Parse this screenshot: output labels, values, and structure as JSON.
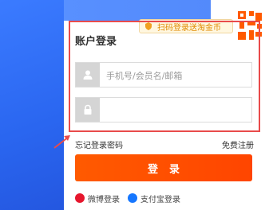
{
  "qr_banner": {
    "text": "扫码登录送淘金币"
  },
  "login": {
    "title": "账户登录",
    "username_placeholder": "手机号/会员名/邮箱",
    "password_placeholder": ""
  },
  "links": {
    "forgot_password": "忘记登录密码",
    "register": "免费注册"
  },
  "login_button": {
    "label": "登录"
  },
  "alt_login": {
    "weibo": "微博登录",
    "alipay": "支付宝登录"
  },
  "colors": {
    "brand_orange": "#ff5000",
    "highlight_red": "#e94b4b",
    "background_blue": "#2a66f0"
  }
}
